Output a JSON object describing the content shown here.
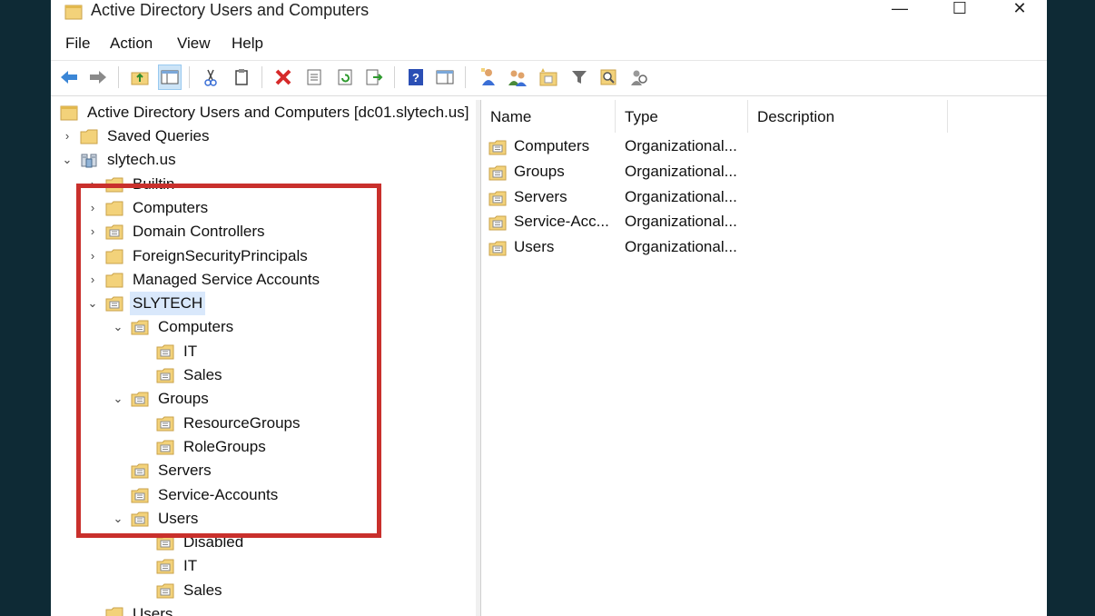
{
  "window": {
    "title": "Active Directory Users and Computers",
    "controls": {
      "minimize": "—",
      "maximize": "☐",
      "close": "✕"
    }
  },
  "menu": [
    "File",
    "Action",
    "View",
    "Help"
  ],
  "toolbar": [
    "back-arrow-icon",
    "forward-arrow-icon",
    "up-folder-icon",
    "show-console-tree-icon",
    "cut-icon",
    "copy-icon",
    "delete-icon",
    "properties-icon",
    "refresh-icon",
    "export-list-icon",
    "help-icon",
    "action-pane-icon",
    "new-user-icon",
    "new-group-icon",
    "new-ou-icon",
    "filter-icon",
    "find-icon",
    "add-to-group-icon"
  ],
  "tree": {
    "root": "Active Directory Users and Computers [dc01.slytech.us]",
    "items": [
      {
        "label": "Saved Queries",
        "chevron": "›",
        "icon": "folder"
      },
      {
        "label": "slytech.us",
        "chevron": "⌄",
        "icon": "domain"
      },
      {
        "label": "Builtin",
        "chevron": "›",
        "icon": "folder"
      },
      {
        "label": "Computers",
        "chevron": "›",
        "icon": "folder"
      },
      {
        "label": "Domain Controllers",
        "chevron": "›",
        "icon": "ou"
      },
      {
        "label": "ForeignSecurityPrincipals",
        "chevron": "›",
        "icon": "folder"
      },
      {
        "label": "Managed Service Accounts",
        "chevron": "›",
        "icon": "folder"
      },
      {
        "label": "SLYTECH",
        "chevron": "⌄",
        "icon": "ou",
        "selected": true
      },
      {
        "label": "Computers",
        "chevron": "⌄",
        "icon": "ou"
      },
      {
        "label": "IT",
        "chevron": "",
        "icon": "ou"
      },
      {
        "label": "Sales",
        "chevron": "",
        "icon": "ou"
      },
      {
        "label": "Groups",
        "chevron": "⌄",
        "icon": "ou"
      },
      {
        "label": "ResourceGroups",
        "chevron": "",
        "icon": "ou"
      },
      {
        "label": "RoleGroups",
        "chevron": "",
        "icon": "ou"
      },
      {
        "label": "Servers",
        "chevron": "",
        "icon": "ou"
      },
      {
        "label": "Service-Accounts",
        "chevron": "",
        "icon": "ou"
      },
      {
        "label": "Users",
        "chevron": "⌄",
        "icon": "ou"
      },
      {
        "label": "Disabled",
        "chevron": "",
        "icon": "ou"
      },
      {
        "label": "IT",
        "chevron": "",
        "icon": "ou"
      },
      {
        "label": "Sales",
        "chevron": "",
        "icon": "ou"
      },
      {
        "label": "Users",
        "chevron": "",
        "icon": "folder"
      }
    ]
  },
  "list": {
    "columns": [
      "Name",
      "Type",
      "Description"
    ],
    "rows": [
      {
        "name": "Computers",
        "type": "Organizational..."
      },
      {
        "name": "Groups",
        "type": "Organizational..."
      },
      {
        "name": "Servers",
        "type": "Organizational..."
      },
      {
        "name": "Service-Acc...",
        "type": "Organizational..."
      },
      {
        "name": "Users",
        "type": "Organizational..."
      }
    ]
  },
  "colors": {
    "highlight": "#c9302c",
    "selection": "#d9e8fb",
    "folder": "#f3d27a",
    "background": "#0e2a35"
  }
}
